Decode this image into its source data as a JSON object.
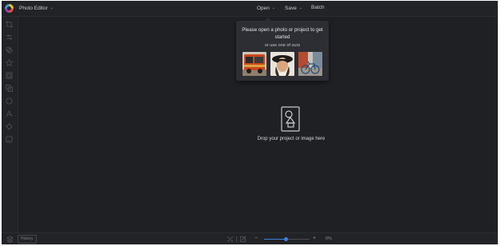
{
  "app": {
    "title": "Photo Editor",
    "accent_color": "#3b82d6"
  },
  "menu": {
    "open_label": "Open",
    "save_label": "Save",
    "batch_label": "Batch"
  },
  "toolbar": {
    "tools": [
      "crop-icon",
      "adjust-icon",
      "filter-icon",
      "effects-icon",
      "frame-icon",
      "overlay-icon",
      "shape-icon",
      "text-icon",
      "texture-icon",
      "sticker-icon"
    ]
  },
  "open_popup": {
    "title": "Please open a photo or project to get started",
    "subtitle": "or use one of ours",
    "samples": [
      "sample-photo-van",
      "sample-photo-portrait",
      "sample-photo-bicycle"
    ]
  },
  "dropzone": {
    "text": "Drop your project or image here"
  },
  "bottombar": {
    "history_label": "History",
    "zoom_out_label": "−",
    "zoom_in_label": "+",
    "zoom_value": "0%",
    "zoom_level_fraction": 0.47
  }
}
